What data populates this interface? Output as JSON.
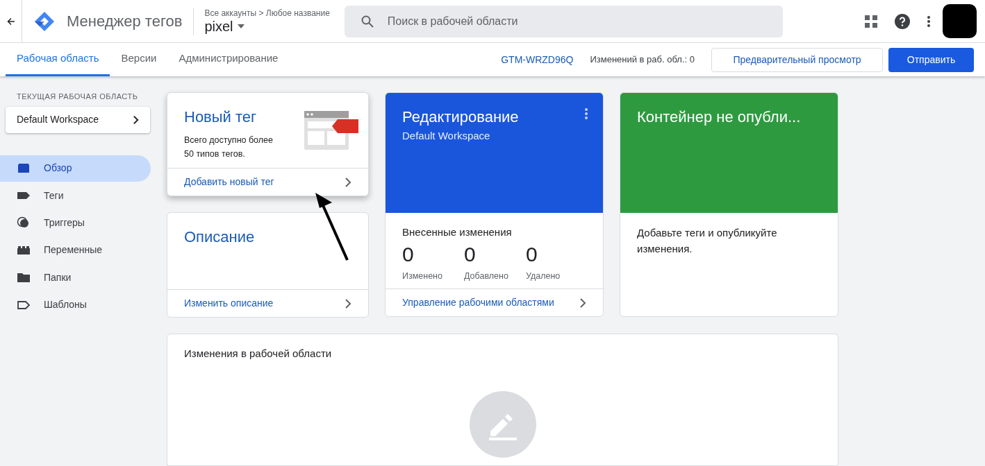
{
  "header": {
    "app_title": "Менеджер тегов",
    "breadcrumb": "Все аккаунты > Любое название",
    "container": "pixel",
    "search": {
      "placeholder": "Поиск в рабочей области"
    }
  },
  "tabs": [
    {
      "label": "Рабочая область",
      "selected": true
    },
    {
      "label": "Версии",
      "selected": false
    },
    {
      "label": "Администрирование",
      "selected": false
    }
  ],
  "toolbar": {
    "container_id": "GTM-WRZD96Q",
    "changes": "Изменений в раб. обл.: 0",
    "preview": "Предварительный просмотр",
    "submit": "Отправить"
  },
  "sidebar": {
    "workspace_label": "ТЕКУЩАЯ РАБОЧАЯ ОБЛАСТЬ",
    "workspace": "Default Workspace",
    "items": [
      {
        "kind": "overview",
        "label": "Обзор",
        "selected": true
      },
      {
        "kind": "tags",
        "label": "Теги",
        "selected": false
      },
      {
        "kind": "triggers",
        "label": "Триггеры",
        "selected": false
      },
      {
        "kind": "variables",
        "label": "Переменные",
        "selected": false
      },
      {
        "kind": "folders",
        "label": "Папки",
        "selected": false
      },
      {
        "kind": "templates",
        "label": "Шаблоны",
        "selected": false
      }
    ]
  },
  "new_tag_card": {
    "title": "Новый тег",
    "description": "Всего доступно более 50 типов тегов.",
    "link": "Добавить новый тег"
  },
  "description_card": {
    "title": "Описание",
    "link": "Изменить описание"
  },
  "workspace_card": {
    "title": "Редактирование",
    "subtitle": "Default Workspace",
    "section": "Внесенные изменения",
    "stats": [
      {
        "value": "0",
        "label": "Изменено"
      },
      {
        "value": "0",
        "label": "Добавлено"
      },
      {
        "value": "0",
        "label": "Удалено"
      }
    ],
    "link": "Управление рабочими областями"
  },
  "publish_card": {
    "title": "Контейнер не опубли...",
    "text": "Добавьте теги и опубликуйте изменения."
  },
  "changes_card": {
    "title": "Изменения в рабочей области"
  }
}
